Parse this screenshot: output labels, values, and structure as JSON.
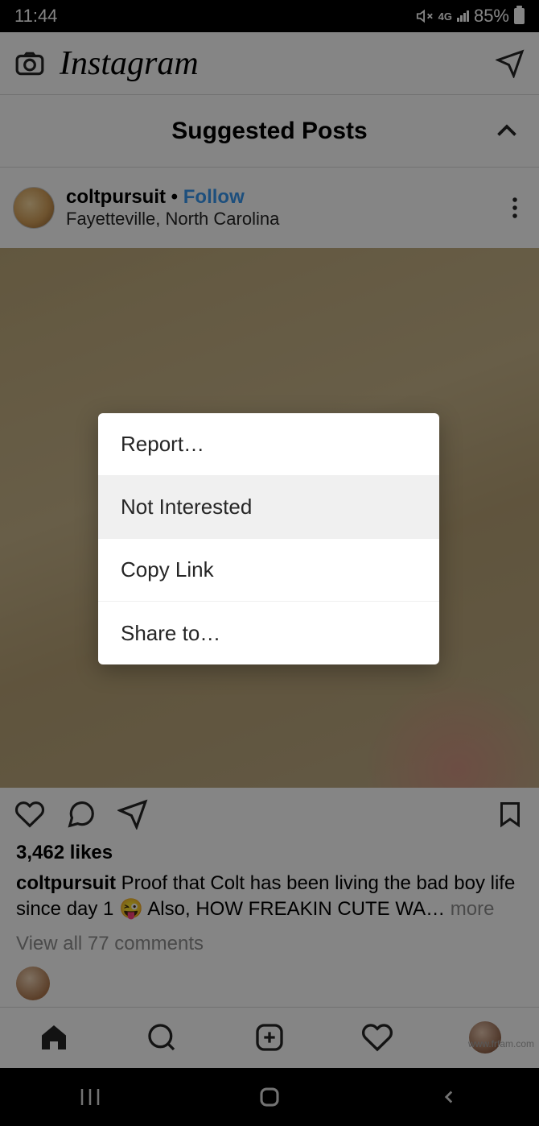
{
  "status": {
    "time": "11:44",
    "network": "4G",
    "battery": "85%"
  },
  "topnav": {
    "logo": "Instagram"
  },
  "suggested": {
    "title": "Suggested Posts"
  },
  "post": {
    "username": "coltpursuit",
    "separator": " • ",
    "follow": "Follow",
    "location": "Fayetteville, North Carolina",
    "likes": "3,462 likes",
    "caption_user": "coltpursuit",
    "caption_text": " Proof that Colt has been living the bad boy life since day 1 😜 Also, HOW FREAKIN CUTE WA…",
    "more": " more",
    "view_comments": "View all 77 comments"
  },
  "menu": {
    "report": "Report…",
    "not_interested": "Not Interested",
    "copy_link": "Copy Link",
    "share_to": "Share to…"
  },
  "watermark": "www.frfam.com"
}
